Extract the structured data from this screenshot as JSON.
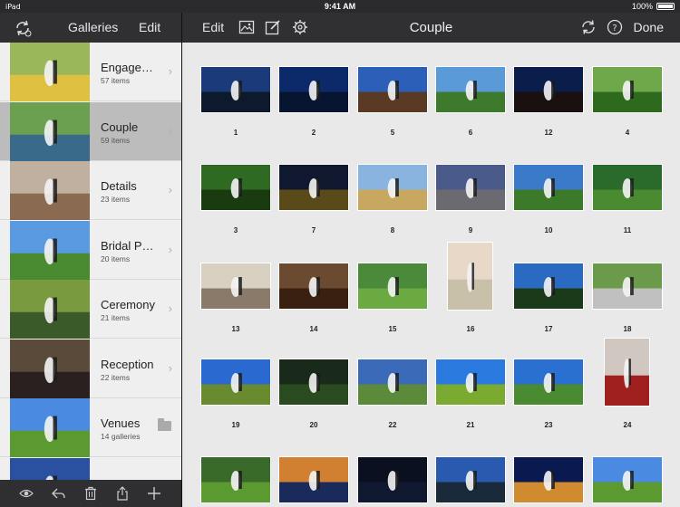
{
  "status": {
    "time": "9:41 AM",
    "battery": "100%"
  },
  "sidebar_header": {
    "galleries_label": "Galleries",
    "edit_label": "Edit"
  },
  "toolbar": {
    "edit_label": "Edit",
    "title": "Couple",
    "done_label": "Done"
  },
  "galleries": [
    {
      "name": "Engage…",
      "count": "57 items",
      "selected": false,
      "kind": "chevron"
    },
    {
      "name": "Couple",
      "count": "59 items",
      "selected": true,
      "kind": "chevron"
    },
    {
      "name": "Details",
      "count": "23 items",
      "selected": false,
      "kind": "chevron"
    },
    {
      "name": "Bridal Pa…",
      "count": "20 items",
      "selected": false,
      "kind": "chevron"
    },
    {
      "name": "Ceremony",
      "count": "21 items",
      "selected": false,
      "kind": "chevron"
    },
    {
      "name": "Reception",
      "count": "22 items",
      "selected": false,
      "kind": "chevron"
    },
    {
      "name": "Venues",
      "count": "14 galleries",
      "selected": false,
      "kind": "folder"
    }
  ],
  "photos": [
    {
      "label": "1",
      "orientation": "landscape",
      "sky": "#1a3a7a",
      "ground": "#0d1a2e"
    },
    {
      "label": "2",
      "orientation": "landscape",
      "sky": "#0c2a6a",
      "ground": "#081530"
    },
    {
      "label": "5",
      "orientation": "landscape",
      "sky": "#2c5fb8",
      "ground": "#5a3a25"
    },
    {
      "label": "6",
      "orientation": "landscape",
      "sky": "#5a9ad8",
      "ground": "#3e7a2c"
    },
    {
      "label": "12",
      "orientation": "landscape",
      "sky": "#0b1d4a",
      "ground": "#1a1010"
    },
    {
      "label": "4",
      "orientation": "landscape",
      "sky": "#6ea84a",
      "ground": "#2e6a1e"
    },
    {
      "label": "3",
      "orientation": "landscape",
      "sky": "#2e6a22",
      "ground": "#1a3a10"
    },
    {
      "label": "7",
      "orientation": "landscape",
      "sky": "#101830",
      "ground": "#5a4a1a"
    },
    {
      "label": "8",
      "orientation": "landscape",
      "sky": "#8ab4e0",
      "ground": "#c8a860"
    },
    {
      "label": "9",
      "orientation": "landscape",
      "sky": "#4a5a8a",
      "ground": "#6a6a70"
    },
    {
      "label": "10",
      "orientation": "landscape",
      "sky": "#3a7ac8",
      "ground": "#3c7a2a"
    },
    {
      "label": "11",
      "orientation": "landscape",
      "sky": "#2a6a2a",
      "ground": "#4a8a30"
    },
    {
      "label": "13",
      "orientation": "landscape",
      "sky": "#d8d0c0",
      "ground": "#8a7a6a"
    },
    {
      "label": "14",
      "orientation": "landscape",
      "sky": "#6a4a30",
      "ground": "#3a2010"
    },
    {
      "label": "15",
      "orientation": "landscape",
      "sky": "#4a8a3a",
      "ground": "#6aaa40"
    },
    {
      "label": "16",
      "orientation": "portrait",
      "sky": "#e8d8c8",
      "ground": "#c8c0a8"
    },
    {
      "label": "17",
      "orientation": "landscape",
      "sky": "#2a6ac0",
      "ground": "#1a3a1a"
    },
    {
      "label": "18",
      "orientation": "landscape",
      "sky": "#6a9a4a",
      "ground": "#c0c0c0"
    },
    {
      "label": "19",
      "orientation": "landscape",
      "sky": "#2a6ad0",
      "ground": "#6a8a30"
    },
    {
      "label": "20",
      "orientation": "landscape",
      "sky": "#1a2a1a",
      "ground": "#2a4a20"
    },
    {
      "label": "22",
      "orientation": "landscape",
      "sky": "#3a6ab8",
      "ground": "#5a8a3a"
    },
    {
      "label": "21",
      "orientation": "landscape",
      "sky": "#2a7ae0",
      "ground": "#7aaa30"
    },
    {
      "label": "23",
      "orientation": "landscape",
      "sky": "#2a70d0",
      "ground": "#4a8a30"
    },
    {
      "label": "24",
      "orientation": "portrait",
      "sky": "#d0c8c0",
      "ground": "#a02020"
    },
    {
      "label": "",
      "orientation": "landscape",
      "sky": "#3a6a2a",
      "ground": "#5a9a30"
    },
    {
      "label": "",
      "orientation": "landscape",
      "sky": "#d08030",
      "ground": "#1a2a5a"
    },
    {
      "label": "",
      "orientation": "landscape",
      "sky": "#0a1020",
      "ground": "#101830"
    },
    {
      "label": "",
      "orientation": "landscape",
      "sky": "#2a5ab0",
      "ground": "#1a2a3a"
    },
    {
      "label": "",
      "orientation": "landscape",
      "sky": "#0a1a50",
      "ground": "#d08a30"
    },
    {
      "label": "",
      "orientation": "landscape",
      "sky": "#4a8ae0",
      "ground": "#5a9a30"
    }
  ],
  "gallery_thumb_colors": [
    {
      "sky": "#9ab85a",
      "ground": "#e0c040"
    },
    {
      "sky": "#6aa050",
      "ground": "#3a6a8a"
    },
    {
      "sky": "#c0b0a0",
      "ground": "#8a6a50"
    },
    {
      "sky": "#5a9ae0",
      "ground": "#4a8a30"
    },
    {
      "sky": "#7a9a40",
      "ground": "#3a5a2a"
    },
    {
      "sky": "#5a4a3a",
      "ground": "#2a2020"
    },
    {
      "sky": "#4a8ae0",
      "ground": "#5a9a30"
    },
    {
      "sky": "#2a50a0",
      "ground": "#1a3070"
    }
  ]
}
